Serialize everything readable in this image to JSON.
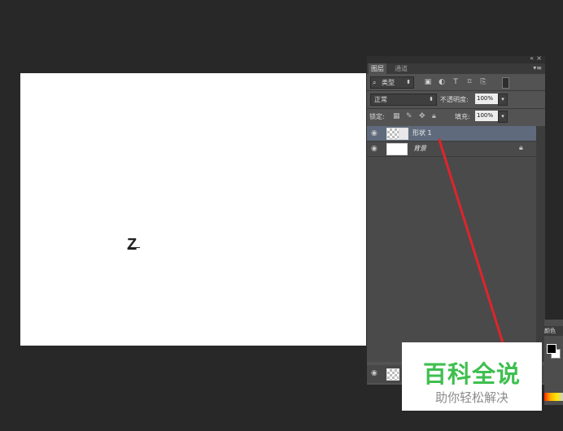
{
  "canvas": {
    "text": "Z"
  },
  "panel": {
    "tabs": [
      "图层",
      "通道"
    ],
    "filter": {
      "label": "类型"
    },
    "blend": {
      "mode": "正常"
    },
    "opacity": {
      "label": "不透明度:",
      "value": "100%"
    },
    "lock": {
      "label": "锁定:"
    },
    "fill": {
      "label": "填充:",
      "value": "100%"
    },
    "layers": [
      {
        "name": "形状 1",
        "selected": true
      },
      {
        "name": "背景",
        "locked": true
      }
    ]
  },
  "color_panel": {
    "tab": "颜色",
    "foreground": "#000000",
    "background": "#ffffff"
  },
  "watermark": {
    "title": "百科全说",
    "subtitle": "助你轻松解决"
  },
  "colors": {
    "selection": "#5f6b7d",
    "annotation": "#e0242b",
    "watermark_green": "#3fbf4f"
  }
}
